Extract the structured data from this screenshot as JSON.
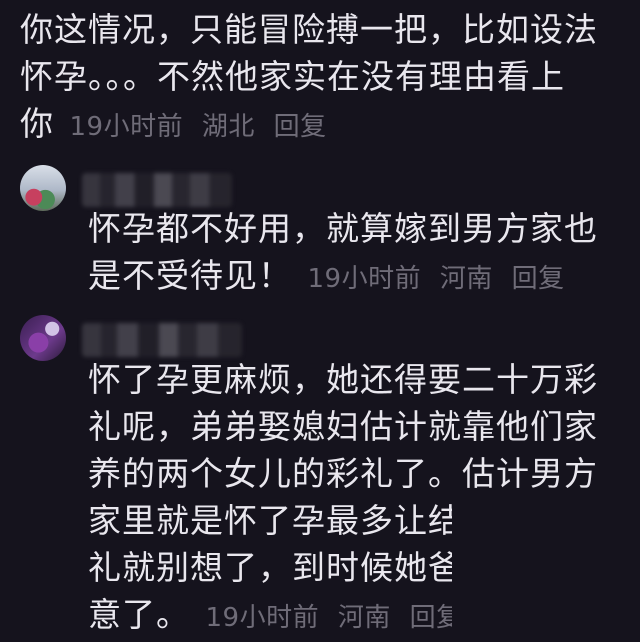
{
  "comment_1": {
    "lines": [
      "你这情况，只能冒险搏一把，比如设法",
      "怀孕。。。不然他家实在没有理由看上",
      "你"
    ],
    "time": "19小时前",
    "location": "湖北",
    "reply_label": "回复"
  },
  "comment_2": {
    "lines": [
      "怀孕都不好用，就算嫁到男方家也",
      "是不受待见！"
    ],
    "time": "19小时前",
    "location": "河南",
    "reply_label": "回复"
  },
  "comment_3": {
    "lines": [
      "怀了孕更麻烦，她还得要二十万彩",
      "礼呢，弟弟娶媳妇估计就靠他们家",
      "养的两个女儿的彩礼了。估计男方",
      "家里就是怀了孕最多让结婚但是彩",
      "礼就别想了，到时候她爸",
      "意了。"
    ],
    "time": "19小时前",
    "location": "河南",
    "reply_label": "回复"
  }
}
